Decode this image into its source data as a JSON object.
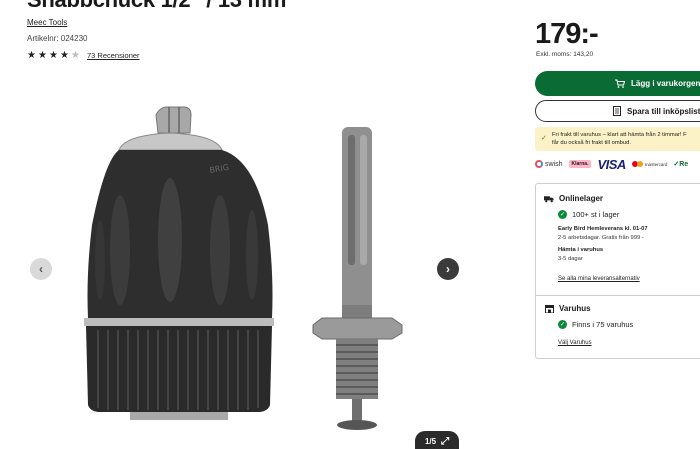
{
  "product": {
    "title": "Snabbchuck 1/2\" / 13 mm",
    "brand": "Meec Tools",
    "article_number": "Artikelnr: 024230",
    "rating": 4,
    "rating_max": 5,
    "reviews": "73 Recensioner"
  },
  "gallery": {
    "counter": "1/5",
    "expand_icon": "⤢"
  },
  "pricing": {
    "price": "179:-",
    "ex_vat": "Exkl. moms: 143,20"
  },
  "actions": {
    "add_to_cart": "Lägg i varukorgen",
    "save_to_list": "Spara till inköpslistan"
  },
  "notice": {
    "line1": "Fri frakt till varuhus – klart att hämta från 2 timmar! F",
    "line2": "får du också fri frakt till ombud."
  },
  "payments": {
    "swish": "swish",
    "klarna": "Klarna.",
    "visa": "VISA",
    "mastercard": "mastercard",
    "resurs": "Re"
  },
  "online": {
    "heading": "Onlinelager",
    "stock": "100+ st i lager",
    "delivery_title": "Early Bird Hemleverans kl. 01-07",
    "delivery_detail": "2-5 arbetsdagar. Gratis från 999 -",
    "pickup_title": "Hämta i varuhus",
    "pickup_detail": "3-5 dagar",
    "link": "Se alla mina leveransalternativ"
  },
  "stores": {
    "heading": "Varuhus",
    "stock": "Finns i 75 varuhus",
    "link": "Välj Varuhus"
  },
  "colors": {
    "primary_green": "#0b6b34",
    "notice_yellow": "#fbf2c8",
    "status_green": "#0b8a3c"
  },
  "icons": [
    "star-icon",
    "chevron-left-icon",
    "chevron-right-icon",
    "expand-icon",
    "cart-icon",
    "list-icon",
    "truck-icon",
    "store-icon",
    "check-icon"
  ]
}
